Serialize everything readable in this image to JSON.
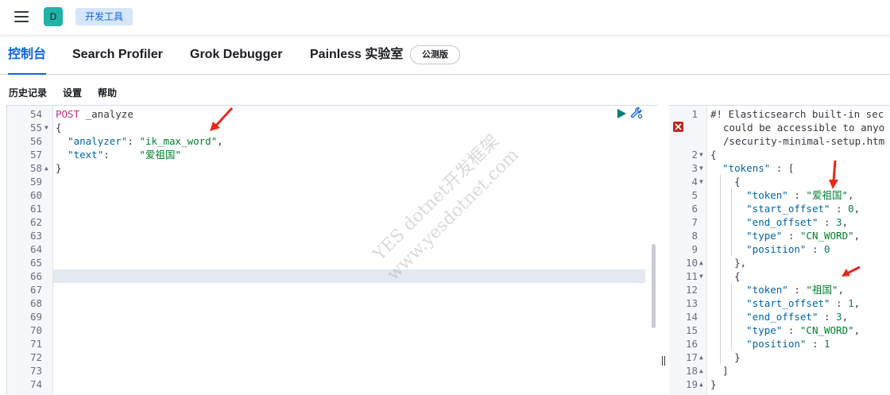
{
  "header": {
    "avatar_letter": "D",
    "breadcrumb": "开发工具",
    "menu_icon": "hamburger-icon"
  },
  "tabs": [
    {
      "label": "控制台",
      "active": true
    },
    {
      "label": "Search Profiler",
      "active": false
    },
    {
      "label": "Grok Debugger",
      "active": false
    },
    {
      "label": "Painless 实验室",
      "active": false
    }
  ],
  "beta_badge": "公测版",
  "menu": {
    "history": "历史记录",
    "settings": "设置",
    "help": "帮助"
  },
  "request_editor": {
    "line_numbers": [
      "54",
      "55",
      "56",
      "57",
      "58",
      "59",
      "60",
      "61",
      "62",
      "63",
      "64",
      "65",
      "66",
      "67",
      "68",
      "69",
      "70",
      "71",
      "72",
      "73",
      "74"
    ],
    "code": {
      "method": "POST",
      "endpoint": " _analyze",
      "open_brace": "{",
      "analyzer_key": "\"analyzer\"",
      "analyzer_value": "\"ik_max_word\"",
      "text_key": "\"text\"",
      "text_value": "\"爱祖国\"",
      "close_brace": "}"
    },
    "active_line": "66",
    "icons": [
      "play-icon",
      "wrench-icon"
    ]
  },
  "response_editor": {
    "line_numbers": [
      "1",
      "2",
      "3",
      "4",
      "5",
      "6",
      "7",
      "8",
      "9",
      "10",
      "11",
      "12",
      "13",
      "14",
      "15",
      "16",
      "17",
      "18",
      "19"
    ],
    "warning_lines": [
      "#! Elasticsearch built-in sec",
      "could be accessible to anyo",
      "/security-minimal-setup.htm"
    ],
    "tokens_key": "\"tokens\"",
    "tokens": [
      {
        "token": "\"爱祖国\"",
        "start_offset": "0",
        "end_offset": "3",
        "type": "\"CN_WORD\"",
        "position": "0"
      },
      {
        "token": "\"祖国\"",
        "start_offset": "1",
        "end_offset": "3",
        "type": "\"CN_WORD\"",
        "position": "1"
      }
    ],
    "keys": {
      "token": "\"token\"",
      "start_offset": "\"start_offset\"",
      "end_offset": "\"end_offset\"",
      "type": "\"type\"",
      "position": "\"position\""
    }
  },
  "watermark": {
    "line1": "YES dotnet开发框架",
    "line2": "www.yesdotnet.com"
  },
  "colors": {
    "accent": "#0b64dd",
    "avatar": "#20b2a6",
    "method": "#c1317a",
    "string": "#00802e",
    "key": "#0064a8",
    "error": "#bd271e",
    "annotation_arrow": "#e8281e"
  }
}
